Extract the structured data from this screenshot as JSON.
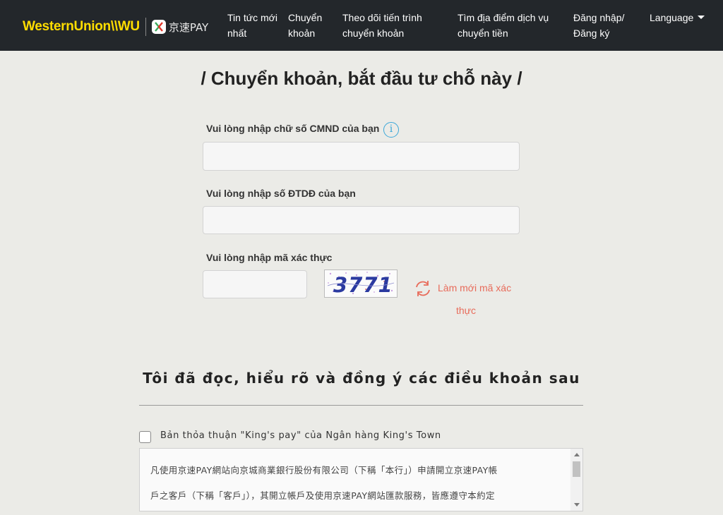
{
  "nav": {
    "brand_wu": "WesternUnion\\\\WU",
    "brand_kp": "京速PAY",
    "items": [
      {
        "line1": "Tin tức mới",
        "line2": "nhất"
      },
      {
        "line1": "Chuyển",
        "line2": "khoản"
      },
      {
        "line1": "Theo dõi tiến trình",
        "line2": "chuyển khoản"
      },
      {
        "line1": "Tìm địa điểm dịch vụ",
        "line2": "chuyển tiền"
      },
      {
        "line1": "Đăng nhập/",
        "line2": "Đăng ký"
      }
    ],
    "language": "Language"
  },
  "page": {
    "title": "/ Chuyển khoản, bắt đầu tư chỗ này /"
  },
  "form": {
    "id_label": "Vui lòng nhập chữ số CMND của bạn",
    "info_glyph": "i",
    "id_value": "",
    "phone_label": "Vui lòng nhập số ĐTDĐ của bạn",
    "phone_value": "",
    "captcha_label": "Vui lòng nhập mã xác thực",
    "captcha_value": "",
    "captcha_code": "3771",
    "refresh_line1": "Làm mới mã xác",
    "refresh_line2": "thực"
  },
  "terms": {
    "heading": "Tôi đã đọc, hiểu rõ và đồng ý các điều khoản sau",
    "agree_label": "Bản thỏa thuận \"King's pay\" của Ngân hàng King's Town",
    "checked": false,
    "text_lines": [
      "凡使用京速PAY網站向京城商業銀行股份有限公司（下稱「本行」）申請開立京速PAY帳",
      "戶之客戶（下稱「客戶」），其開立帳戶及使用京速PAY網站匯款服務，皆應遵守本約定"
    ]
  },
  "colors": {
    "navbar": "#23272b",
    "wu_yellow": "#ffdd00",
    "captcha_blue": "#2b3aa0",
    "refresh_red": "#e86b5a",
    "info_blue": "#3aa7d9"
  }
}
